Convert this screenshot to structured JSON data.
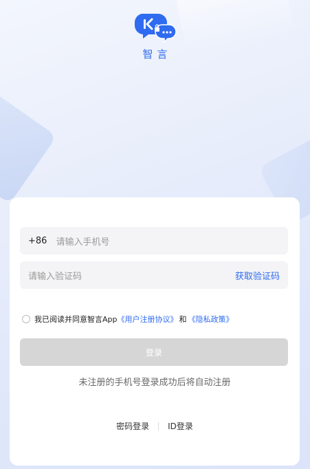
{
  "app": {
    "name": "智言"
  },
  "form": {
    "country_code": "+86",
    "phone_placeholder": "请输入手机号",
    "code_placeholder": "请输入验证码",
    "get_code_label": "获取验证码"
  },
  "agreement": {
    "prefix": "我已阅读并同意智言App",
    "user_agreement": "《用户注册协议》",
    "and": "和",
    "privacy_policy": "《隐私政策》"
  },
  "login_button": "登录",
  "hint": "未注册的手机号登录成功后将自动注册",
  "alt_login": {
    "password": "密码登录",
    "id": "ID登录"
  },
  "colors": {
    "accent": "#2f6bf0",
    "disabled_button": "#d6d6d6"
  }
}
